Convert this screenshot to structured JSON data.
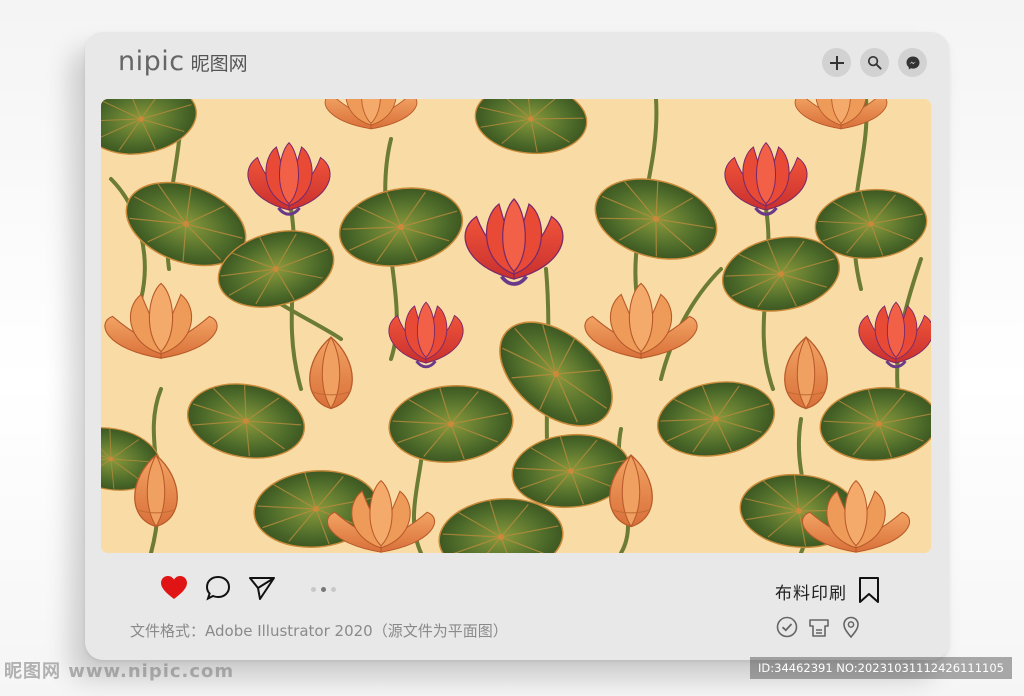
{
  "header": {
    "logo_text": "nipic",
    "logo_cn": "昵图网",
    "icons": [
      "plus-icon",
      "search-icon",
      "messenger-icon"
    ]
  },
  "image": {
    "background_color": "#f9dca5",
    "subject": "lotus-pattern"
  },
  "actions": {
    "like_color": "#e01414",
    "carousel_pages": 3,
    "carousel_active": 2,
    "tag_label": "布料印刷"
  },
  "footer": {
    "format_text": "文件格式：Adobe Illustrator 2020（源文件为平面图）",
    "icons": [
      "check-circle-icon",
      "print-icon",
      "location-pin-icon"
    ]
  },
  "watermark": {
    "left_text": "昵图网 www.nipic.com",
    "right_text": "ID:34462391 NO:20231031112426111105"
  }
}
